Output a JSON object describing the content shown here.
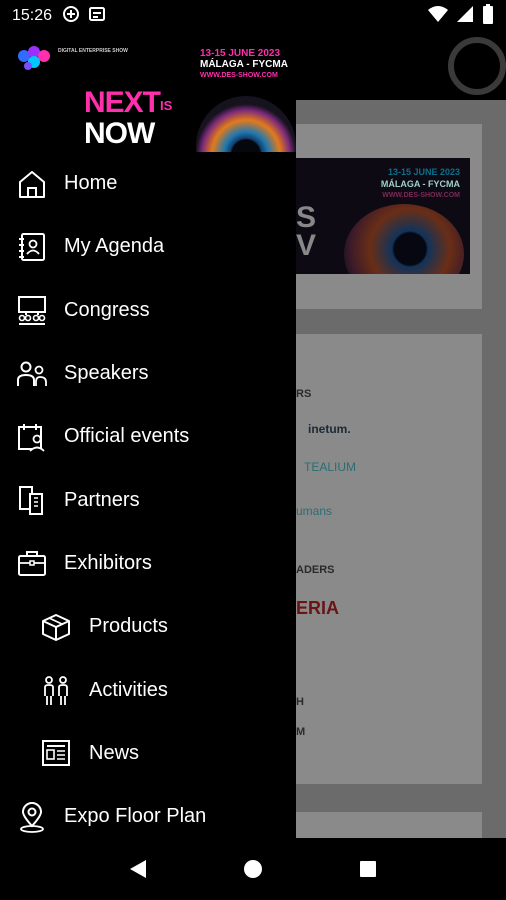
{
  "status_bar": {
    "time": "15:26",
    "left_icons": [
      "data-saver-icon",
      "notification-card-icon"
    ],
    "right_icons": [
      "wifi-icon",
      "signal-icon",
      "battery-icon"
    ]
  },
  "drawer_header": {
    "event_dates": "13-15 JUNE 2023",
    "event_venue": "MÁLAGA - FYCMA",
    "event_url": "WWW.DES-SHOW.COM",
    "logo_text": "DIGITAL ENTERPRISE SHOW",
    "slogan_next": "NEXT",
    "slogan_is": "IS",
    "slogan_now": "NOW"
  },
  "menu": {
    "items": [
      {
        "label": "Home",
        "icon": "home-icon"
      },
      {
        "label": "My Agenda",
        "icon": "agenda-icon"
      },
      {
        "label": "Congress",
        "icon": "congress-icon"
      },
      {
        "label": "Speakers",
        "icon": "speakers-icon"
      },
      {
        "label": "Official events",
        "icon": "official-events-icon"
      },
      {
        "label": "Partners",
        "icon": "partners-icon"
      },
      {
        "label": "Exhibitors",
        "icon": "exhibitors-icon"
      },
      {
        "label": "Products",
        "icon": "products-icon"
      },
      {
        "label": "Activities",
        "icon": "activities-icon"
      },
      {
        "label": "News",
        "icon": "news-icon"
      },
      {
        "label": "Expo Floor Plan",
        "icon": "map-pin-icon"
      }
    ]
  },
  "background": {
    "banner_dates": "13-15 JUNE 2023",
    "banner_venue": "MÁLAGA - FYCMA",
    "banner_url": "WWW.DES-SHOW.COM",
    "section1_fragment": "RS",
    "partner1": "inetum.",
    "partner2": "TEALIUM",
    "partner3": "umans",
    "section2_fragment": "ADERS",
    "partner4": "ERIA",
    "section3_fragment": "H",
    "section4_fragment": "M"
  },
  "nav_bar": {
    "back": "back-icon",
    "home": "home-circle-icon",
    "recents": "recents-icon"
  },
  "colors": {
    "accent_pink": "#ff2fae",
    "drawer_bg": "#000000",
    "scrim": "#6b6b6b"
  }
}
